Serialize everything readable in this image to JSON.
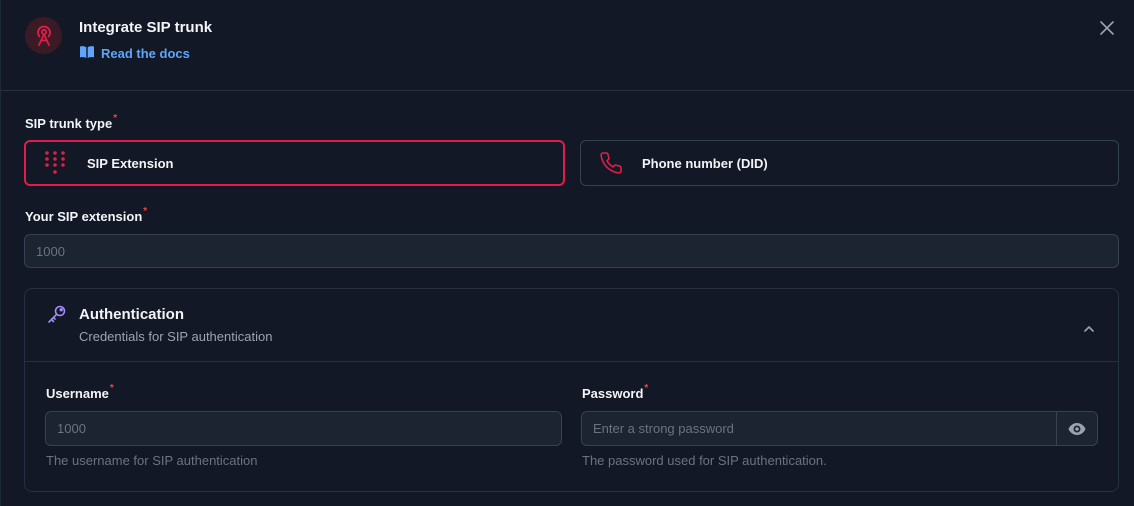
{
  "header": {
    "title": "Integrate SIP trunk",
    "docs_link": "Read the docs"
  },
  "trunk_type": {
    "label": "SIP trunk type",
    "required_mark": "*",
    "options": [
      {
        "label": "SIP Extension",
        "icon": "dialpad-icon",
        "selected": true
      },
      {
        "label": "Phone number (DID)",
        "icon": "phone-icon",
        "selected": false
      }
    ]
  },
  "extension": {
    "label": "Your SIP extension",
    "required_mark": "*",
    "placeholder": "1000"
  },
  "auth": {
    "title": "Authentication",
    "subtitle": "Credentials for SIP authentication",
    "username": {
      "label": "Username",
      "required_mark": "*",
      "placeholder": "1000",
      "hint": "The username for SIP authentication"
    },
    "password": {
      "label": "Password",
      "required_mark": "*",
      "placeholder": "Enter a strong password",
      "hint": "The password used for SIP authentication."
    }
  },
  "colors": {
    "accent": "#e11d48",
    "link": "#60a5fa",
    "background": "#121826"
  }
}
